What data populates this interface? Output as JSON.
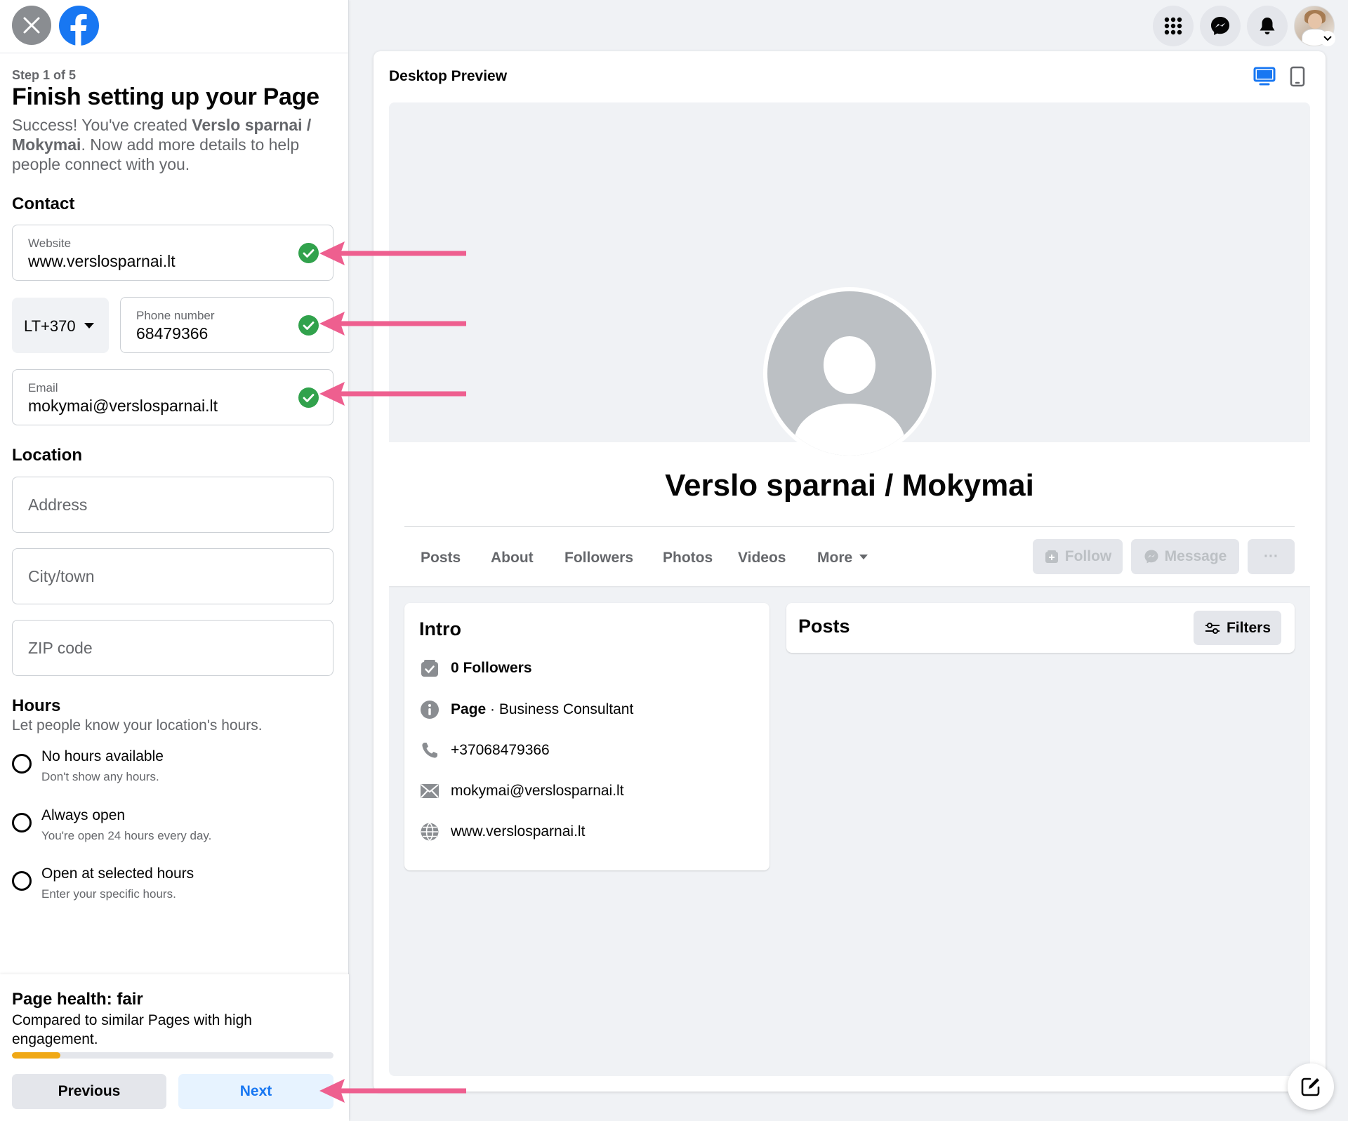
{
  "setup": {
    "step": "Step 1 of 5",
    "title": "Finish setting up your Page",
    "subtitle_prefix": "Success! You've created ",
    "subtitle_page": "Verslo sparnai / Mokymai",
    "subtitle_suffix": ". Now add more details to help people connect with you."
  },
  "contact": {
    "heading": "Contact",
    "website_label": "Website",
    "website_value": "www.verslosparnai.lt",
    "country_code": "LT+370",
    "phone_label": "Phone number",
    "phone_value": "68479366",
    "email_label": "Email",
    "email_value": "mokymai@verslosparnai.lt"
  },
  "location": {
    "heading": "Location",
    "address_placeholder": "Address",
    "city_placeholder": "City/town",
    "zip_placeholder": "ZIP code"
  },
  "hours": {
    "heading": "Hours",
    "subtitle": "Let people know your location's hours.",
    "options": [
      {
        "title": "No hours available",
        "sub": "Don't show any hours."
      },
      {
        "title": "Always open",
        "sub": "You're open 24 hours every day."
      },
      {
        "title": "Open at selected hours",
        "sub": "Enter your specific hours."
      }
    ]
  },
  "health": {
    "title": "Page health: fair",
    "subtitle": "Compared to similar Pages with high engagement.",
    "progress_fraction": 0.15,
    "previous_label": "Previous",
    "next_label": "Next"
  },
  "preview": {
    "title": "Desktop Preview",
    "page_name": "Verslo sparnai / Mokymai",
    "tabs": [
      "Posts",
      "About",
      "Followers",
      "Photos",
      "Videos",
      "More"
    ],
    "actions": {
      "follow": "Follow",
      "message": "Message",
      "more": "···"
    },
    "intro": {
      "title": "Intro",
      "followers": "0 Followers",
      "page_type_bold": "Page",
      "page_type_rest": " · Business Consultant",
      "phone": "+37068479366",
      "email": "mokymai@verslosparnai.lt",
      "website": "www.verslosparnai.lt"
    },
    "posts": {
      "title": "Posts",
      "filters_label": "Filters"
    }
  },
  "colors": {
    "brand": "#1877f2",
    "success": "#31a24c",
    "arrow": "#ee5f8f",
    "health_fill": "#f0a815"
  },
  "icons": [
    "close-icon",
    "facebook-logo-icon",
    "menu-grid-icon",
    "messenger-icon",
    "bell-icon",
    "desktop-icon",
    "mobile-icon",
    "check-icon",
    "compose-icon"
  ]
}
